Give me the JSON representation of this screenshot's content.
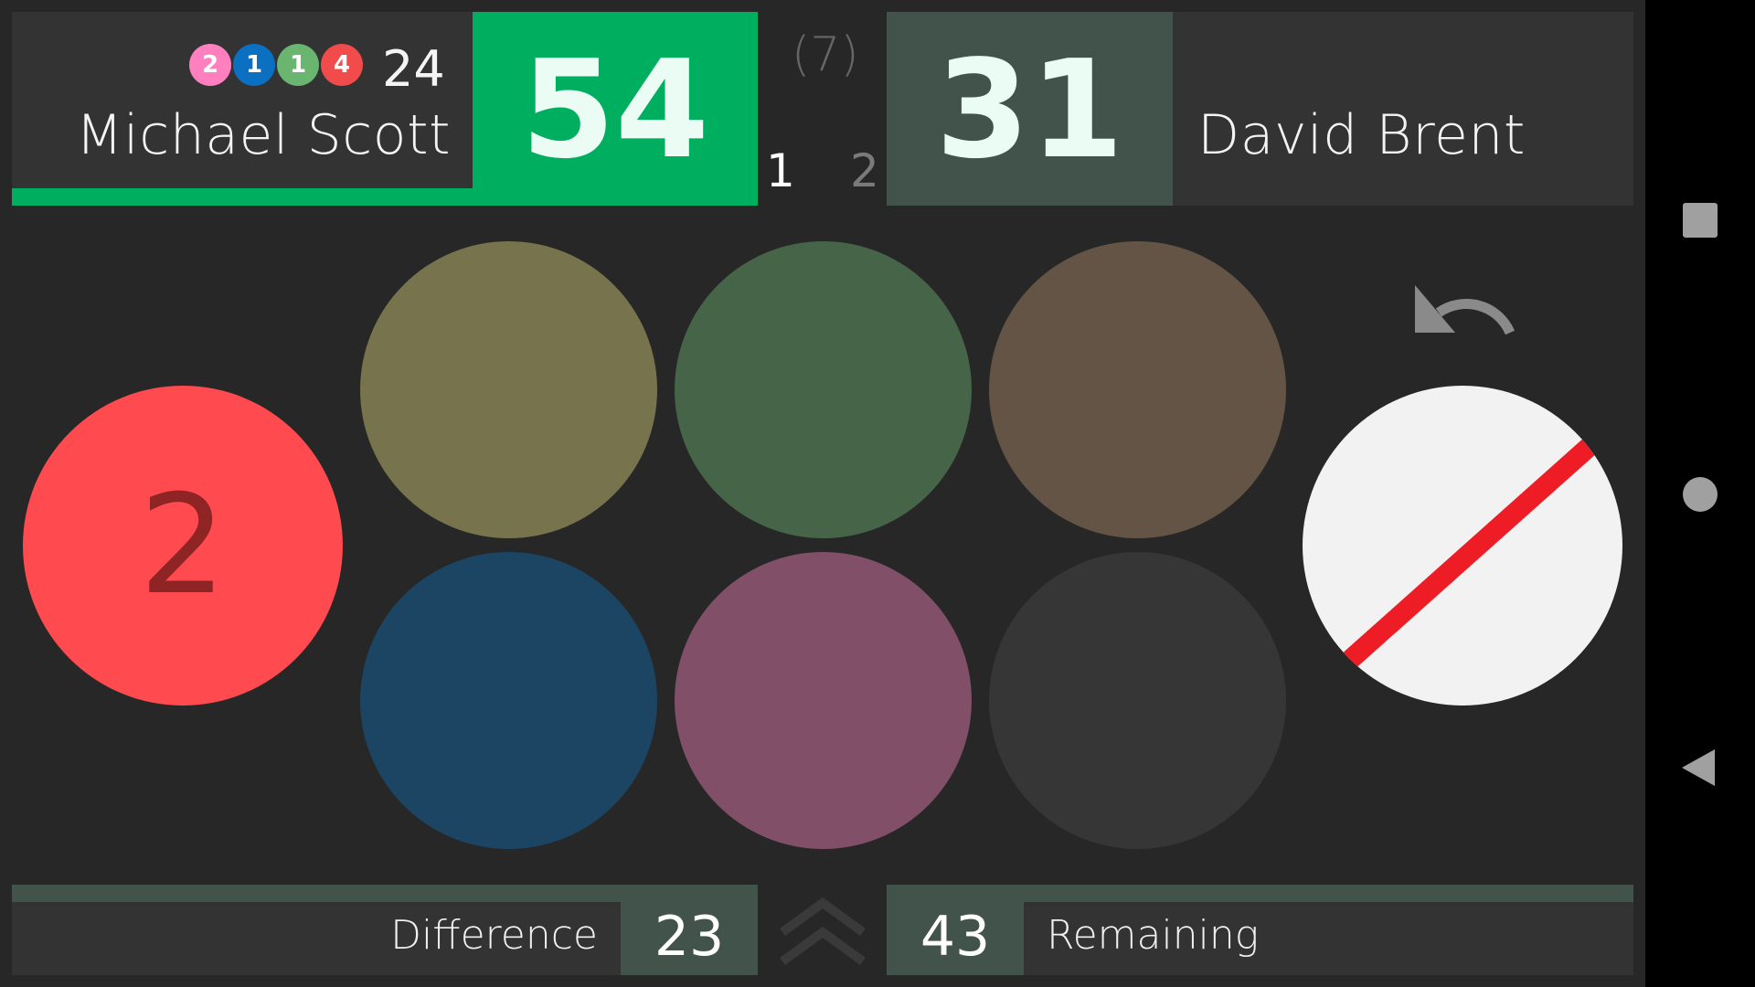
{
  "player1": {
    "name": "Michael Scott",
    "score": "54",
    "break_total": "24",
    "break_balls": [
      {
        "label": "2",
        "color": "#ff7fbf"
      },
      {
        "label": "1",
        "color": "#0b6fc2"
      },
      {
        "label": "1",
        "color": "#6ab56f"
      },
      {
        "label": "4",
        "color": "#f24b4b"
      }
    ],
    "frames_won": "1"
  },
  "player2": {
    "name": "David Brent",
    "score": "31",
    "frames_won": "2"
  },
  "match": {
    "total_frames": "(7)"
  },
  "balls": {
    "current": {
      "label": "2",
      "color": "#ff4a4f"
    },
    "grid": [
      {
        "name": "yellow",
        "color": "#77734c"
      },
      {
        "name": "green",
        "color": "#466447"
      },
      {
        "name": "brown",
        "color": "#645445"
      },
      {
        "name": "blue",
        "color": "#1b4562"
      },
      {
        "name": "pink",
        "color": "#814f68"
      },
      {
        "name": "black",
        "color": "#363636"
      }
    ],
    "foul_color": "#f2f2f2",
    "foul_stripe_color": "#ee1c25"
  },
  "stats": {
    "difference_label": "Difference",
    "difference_value": "23",
    "remaining_label": "Remaining",
    "remaining_value": "43"
  },
  "icons": {
    "undo": "undo-icon",
    "chevron": "double-chevron-up-icon",
    "nav_recents": "square-icon",
    "nav_home": "circle-icon",
    "nav_back": "back-triangle-icon"
  }
}
